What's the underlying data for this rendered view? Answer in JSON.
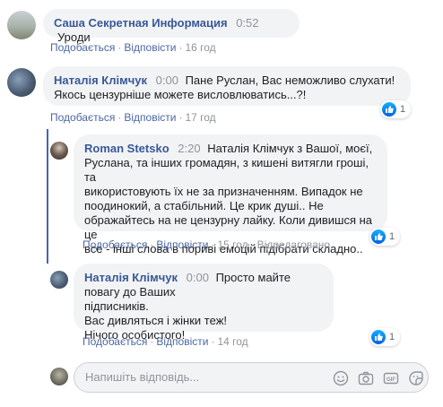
{
  "comments": [
    {
      "author": "Саша Секретная Информация",
      "time": "0:52",
      "text": "Уроди",
      "like_label": "Подобається",
      "reply_label": "Відповісти",
      "age": "16 год"
    },
    {
      "author": "Наталія Клімчук",
      "time": "0:00",
      "text_line1": "Пане Руслан, Вас неможливо слухати!",
      "text_line2": "Якось цензурніше можете висловлюватись...?!",
      "like_label": "Подобається",
      "reply_label": "Відповісти",
      "age": "17 год",
      "reactions": "1"
    },
    {
      "author": "Roman Stetsko",
      "time": "2:20",
      "lines": [
        "Наталія Клімчук з Вашої, моєї,",
        "Руслана, та інших громадян, з кишені витягли гроші, та",
        "використовують їх не за призначенням. Випадок не",
        "поодинокий, а стабільний. Це крик душі.. Не",
        "ображайтесь на не цензурну лайку. Коли дивишся на це",
        "все - інші слова в пориві емоцій підібрати складно.."
      ],
      "like_label": "Подобається",
      "reply_label": "Відповісти",
      "age": "15 год",
      "edited": "Відредаговано",
      "reactions": "1"
    },
    {
      "author": "Наталія Клімчук",
      "time": "0:00",
      "lines": [
        "Просто майте повагу до Ваших",
        "підписників.",
        "Вас дивляться і жінки теж!",
        "Нічого особистого!"
      ],
      "like_label": "Подобається",
      "reply_label": "Відповісти",
      "age": "14 год",
      "reactions": "1"
    }
  ],
  "reply_box": {
    "placeholder": "Напишіть відповідь...",
    "icons": [
      "smiley-icon",
      "camera-icon",
      "gif-icon",
      "sticker-icon"
    ]
  },
  "colors": {
    "author": "#385898",
    "link": "#4b67a1",
    "bubble": "#f2f3f5",
    "thread_line": "#4267b2",
    "like_blue": "#1877f2"
  }
}
